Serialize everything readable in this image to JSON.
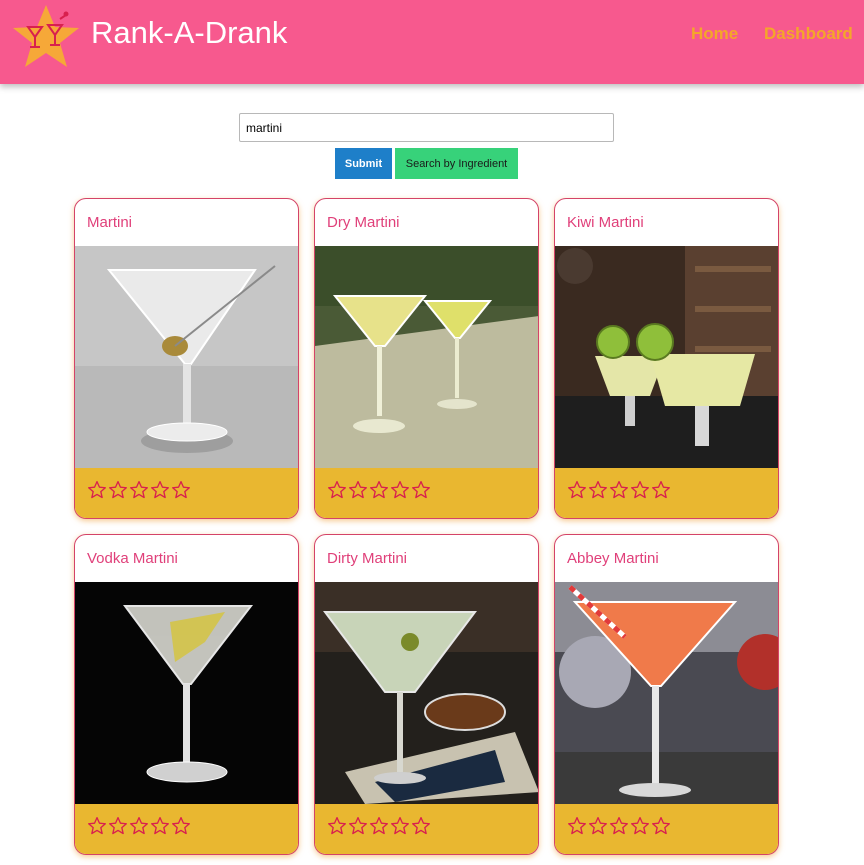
{
  "header": {
    "brand": "Rank-A-Drank",
    "nav": {
      "home": "Home",
      "dashboard": "Dashboard"
    }
  },
  "search": {
    "value": "martini",
    "submit_label": "Submit",
    "ingredient_label": "Search by Ingredient"
  },
  "colors": {
    "header_bg": "#f7598e",
    "nav_link": "#f4a62a",
    "card_title": "#e0407a",
    "card_footer": "#e9b730",
    "star_outline": "#d8204e",
    "submit_bg": "#1e7fc9",
    "ingredient_bg": "#37d27a"
  },
  "cards": [
    {
      "title": "Martini",
      "rating": 0,
      "stars_total": 5
    },
    {
      "title": "Dry Martini",
      "rating": 0,
      "stars_total": 5
    },
    {
      "title": "Kiwi Martini",
      "rating": 0,
      "stars_total": 5
    },
    {
      "title": "Vodka Martini",
      "rating": 0,
      "stars_total": 5
    },
    {
      "title": "Dirty Martini",
      "rating": 0,
      "stars_total": 5
    },
    {
      "title": "Abbey Martini",
      "rating": 0,
      "stars_total": 5
    }
  ]
}
